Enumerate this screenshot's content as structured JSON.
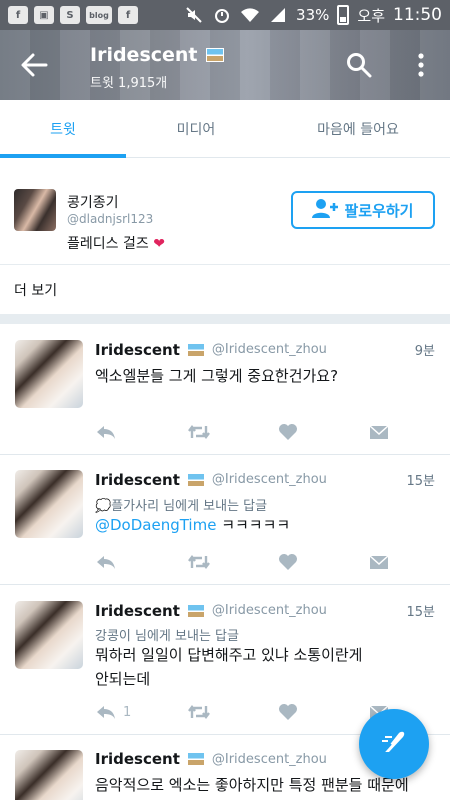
{
  "status_bar": {
    "notification_icons": [
      "f",
      "blog",
      "f"
    ],
    "battery_percent": "33%",
    "ampm": "오후",
    "time": "11:50"
  },
  "header": {
    "title": "Iridescent",
    "subtitle": "트윗 1,915개"
  },
  "tabs": [
    {
      "label": "트윗",
      "active": true
    },
    {
      "label": "미디어",
      "active": false
    },
    {
      "label": "마음에 들어요",
      "active": false
    }
  ],
  "suggestion": {
    "name": "콩기종기",
    "handle": "@dladnjsrl123",
    "bio": "플레디스 걸즈",
    "bio_emoji": "❤",
    "follow_label": "팔로우하기"
  },
  "more_label": "더 보기",
  "tweets": [
    {
      "name": "Iridescent",
      "handle": "@Iridescent_zhou",
      "time": "9분",
      "reply_to": "",
      "mention": "",
      "lines": [
        "엑소엘분들 그게 그렇게 중요한건가요?"
      ],
      "reply_count": ""
    },
    {
      "name": "Iridescent",
      "handle": "@Iridescent_zhou",
      "time": "15분",
      "reply_to": "💭플가사리 님에게 보내는 답글",
      "mention": "@DoDaengTime",
      "lines": [
        " ㅋㅋㅋㅋㅋ"
      ],
      "reply_count": ""
    },
    {
      "name": "Iridescent",
      "handle": "@Iridescent_zhou",
      "time": "15분",
      "reply_to": "강콩이 님에게 보내는 답글",
      "mention": "",
      "lines": [
        "뭐하러 일일이 답변해주고 있냐 소통이란게",
        "안되는데"
      ],
      "reply_count": "1"
    },
    {
      "name": "Iridescent",
      "handle": "@Iridescent_zhou",
      "time": "",
      "reply_to": "",
      "mention": "",
      "lines": [
        "음악적으로 엑소는 좋아하지만 특정 팬분들 때문에"
      ],
      "reply_count": ""
    }
  ],
  "colors": {
    "accent": "#1da1f2",
    "heart": "#e0245e",
    "muted": "#8899a6"
  }
}
